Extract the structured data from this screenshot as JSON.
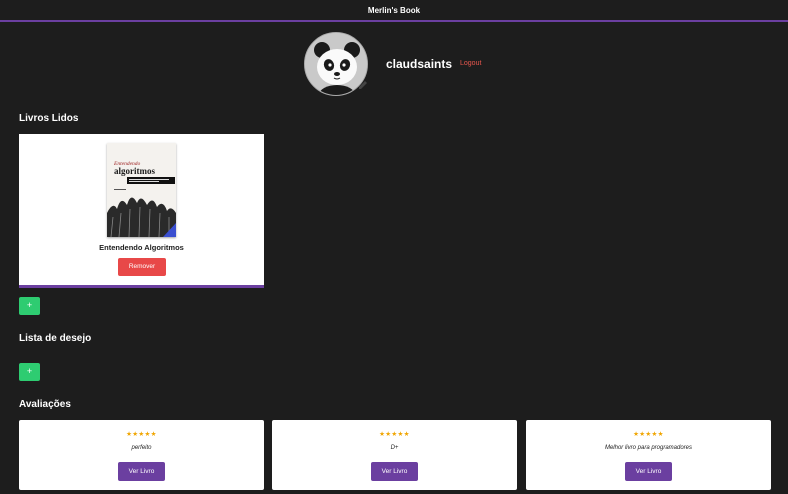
{
  "app": {
    "title": "Merlin's Book"
  },
  "profile": {
    "username": "claudsaints",
    "logout_label": "Logout",
    "avatar_icon": "panda-avatar"
  },
  "sections": {
    "read_books": "Livros Lidos",
    "wishlist": "Lista de desejo",
    "reviews": "Avaliações"
  },
  "read_books": [
    {
      "title": "Entendendo Algoritmos",
      "remove_label": "Remover",
      "cover_title": [
        "Entendendo",
        "algoritmos"
      ]
    }
  ],
  "add_label": "+",
  "reviews": [
    {
      "stars": "★★★★★",
      "rating": 5,
      "text": "perfeito",
      "button_label": "Ver Livro"
    },
    {
      "stars": "★★★★★",
      "rating": 5,
      "text": "D+",
      "button_label": "Ver Livro"
    },
    {
      "stars": "★★★★★",
      "rating": 5,
      "text": "Melhor livro para programadores",
      "button_label": "Ver Livro"
    }
  ],
  "colors": {
    "accent": "#6b3fa0",
    "danger": "#e84848",
    "success": "#2ecc71",
    "star": "#f0a500",
    "background": "#1d1d1d"
  }
}
